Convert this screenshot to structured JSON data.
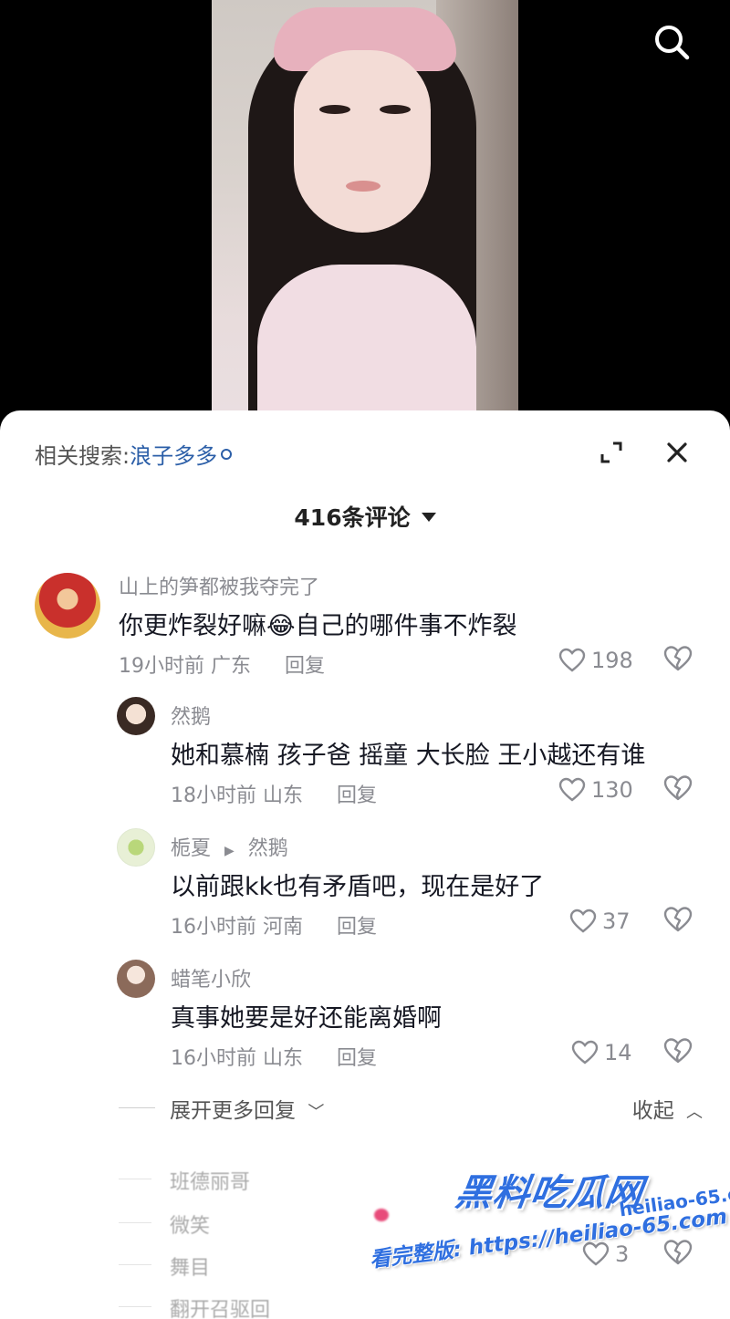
{
  "header": {
    "search_icon": "search-icon"
  },
  "panel": {
    "related_prefix": "相关搜索:",
    "related_keyword": "浪子多多",
    "comment_count": "416条评论",
    "icons": {
      "expand": "expand-icon",
      "close": "close-icon"
    }
  },
  "comments": [
    {
      "user": "山上的笋都被我夺完了",
      "text": "你更炸裂好嘛😂自己的哪件事不炸裂",
      "time": "19小时前",
      "location": "广东",
      "reply": "回复",
      "likes": "198"
    },
    {
      "user": "然鹅",
      "text": "她和慕楠 孩子爸 摇童 大长脸 王小越还有谁",
      "time": "18小时前",
      "location": "山东",
      "reply": "回复",
      "likes": "130"
    },
    {
      "user": "栀夏",
      "reply_to": "然鹅",
      "text": "以前跟kk也有矛盾吧，现在是好了",
      "time": "16小时前",
      "location": "河南",
      "reply": "回复",
      "likes": "37"
    },
    {
      "user": "蜡笔小欣",
      "text": "真事她要是好还能离婚啊",
      "time": "16小时前",
      "location": "山东",
      "reply": "回复",
      "likes": "14"
    }
  ],
  "thread": {
    "expand_more": "展开更多回复",
    "collapse": "收起"
  },
  "faded_items": [
    "班德丽哥",
    "微笑",
    "舞目",
    "翻开召驱回"
  ],
  "faded_likes": "3",
  "watermark": {
    "title": "黑料吃瓜网",
    "domain": "heiliao-65.com",
    "url_line": "看完整版: https://heiliao-65.com"
  },
  "colors": {
    "accent_link": "#2c5fa8",
    "watermark_blue": "#2f6fe0",
    "text_primary": "#161823",
    "text_secondary": "#8a8b91"
  }
}
